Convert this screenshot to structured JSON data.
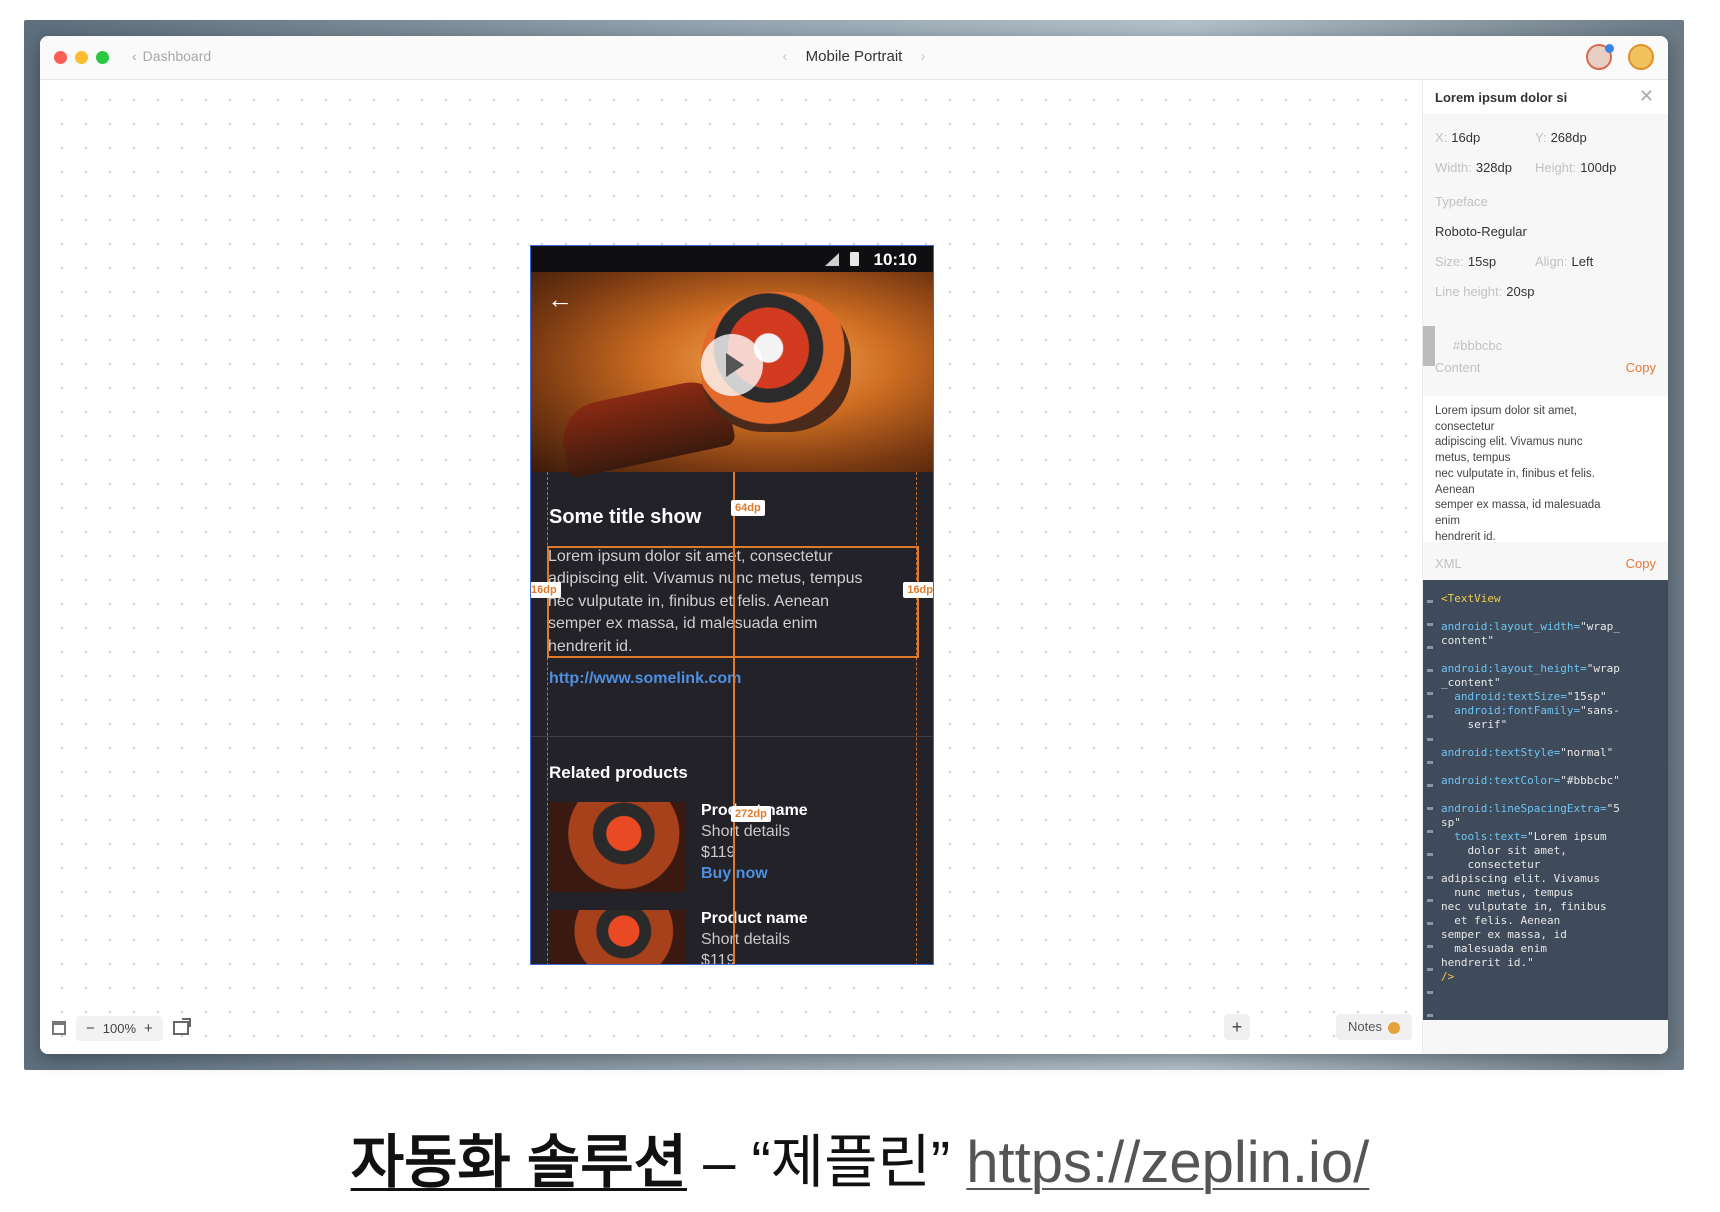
{
  "window": {
    "back_label": "Dashboard",
    "screen_title": "Mobile Portrait",
    "prev_arrow": "‹",
    "next_arrow": "›"
  },
  "phone": {
    "clock": "10:10",
    "section_title": "Some title show",
    "body_lines": [
      "Lorem ipsum dolor sit amet, consectetur",
      "adipiscing elit. Vivamus nunc metus, tempus",
      "nec vulputate in, finibus et felis. Aenean",
      "semper ex massa, id malesuada enim",
      "hendrerit id."
    ],
    "link": "http://www.somelink.com",
    "related_title": "Related products",
    "products": [
      {
        "name": "Product name",
        "details": "Short details",
        "price": "$119",
        "buy": "Buy now"
      },
      {
        "name": "Product name",
        "details": "Short details",
        "price": "$119"
      }
    ],
    "measurements": {
      "top_gap": "64dp",
      "left_pad": "16dp",
      "right_pad": "16dp",
      "width": "272dp"
    }
  },
  "canvas_toolbar": {
    "zoom_minus": "−",
    "zoom_level": "100%",
    "zoom_plus": "+",
    "add": "+",
    "notes": "Notes"
  },
  "panel": {
    "title": "Lorem ipsum dolor si",
    "x_label": "X:",
    "x_value": "16dp",
    "y_label": "Y:",
    "y_value": "268dp",
    "width_label": "Width:",
    "width_value": "328dp",
    "height_label": "Height:",
    "height_value": "100dp",
    "typeface_label": "Typeface",
    "font_name": "Roboto-Regular",
    "size_label": "Size:",
    "size_value": "15sp",
    "align_label": "Align:",
    "align_value": "Left",
    "line_height_label": "Line height:",
    "line_height_value": "20sp",
    "color_hex": "#bbbcbc",
    "content_label": "Content",
    "content_copy": "Copy",
    "content_lines": [
      "Lorem ipsum dolor sit amet,",
      "consectetur",
      "adipiscing elit. Vivamus nunc",
      "metus, tempus",
      "nec vulputate in, finibus et felis.",
      "Aenean",
      "semper ex massa, id malesuada",
      "enim",
      "hendrerit id."
    ],
    "xml_label": "XML",
    "xml_copy": "Copy",
    "xml_lines": [
      {
        "tag": "<TextView"
      },
      {
        "attr": "android:layout_width=",
        "val": "\"wrap_"
      },
      {
        "val": "content\""
      },
      {
        "attr": "android:layout_height=",
        "val": "\"wrap"
      },
      {
        "val": "_content\""
      },
      {
        "attr": "  android:textSize=",
        "val": "\"15sp\""
      },
      {
        "attr": "  android:fontFamily=",
        "val": "\"sans-"
      },
      {
        "val": "    serif\""
      },
      {
        "attr": "android:textStyle=",
        "val": "\"normal\""
      },
      {
        "attr": "android:textColor=",
        "val": "\"#bbbcbc\""
      },
      {
        "attr": "android:lineSpacingExtra=",
        "val": "\"5"
      },
      {
        "val": "sp\""
      },
      {
        "attr": "  tools:text=",
        "val": "\"Lorem ipsum"
      },
      {
        "val": "    dolor sit amet,"
      },
      {
        "val": "    consectetur"
      },
      {
        "val": "adipiscing elit. Vivamus"
      },
      {
        "val": "  nunc metus, tempus"
      },
      {
        "val": "nec vulputate in, finibus"
      },
      {
        "val": "  et felis. Aenean"
      },
      {
        "val": "semper ex massa, id"
      },
      {
        "val": "  malesuada enim"
      },
      {
        "val": "hendrerit id.\""
      },
      {
        "tag": "/>"
      }
    ]
  },
  "caption": {
    "korean": "자동화 솔루션",
    "dash": " – “제플린” ",
    "url": "https://zeplin.io/"
  },
  "colors": {
    "accent_orange": "#e07a2a",
    "link_blue": "#4f8fe0",
    "phone_bg": "#222228",
    "xml_bg": "#3f4a5a"
  }
}
